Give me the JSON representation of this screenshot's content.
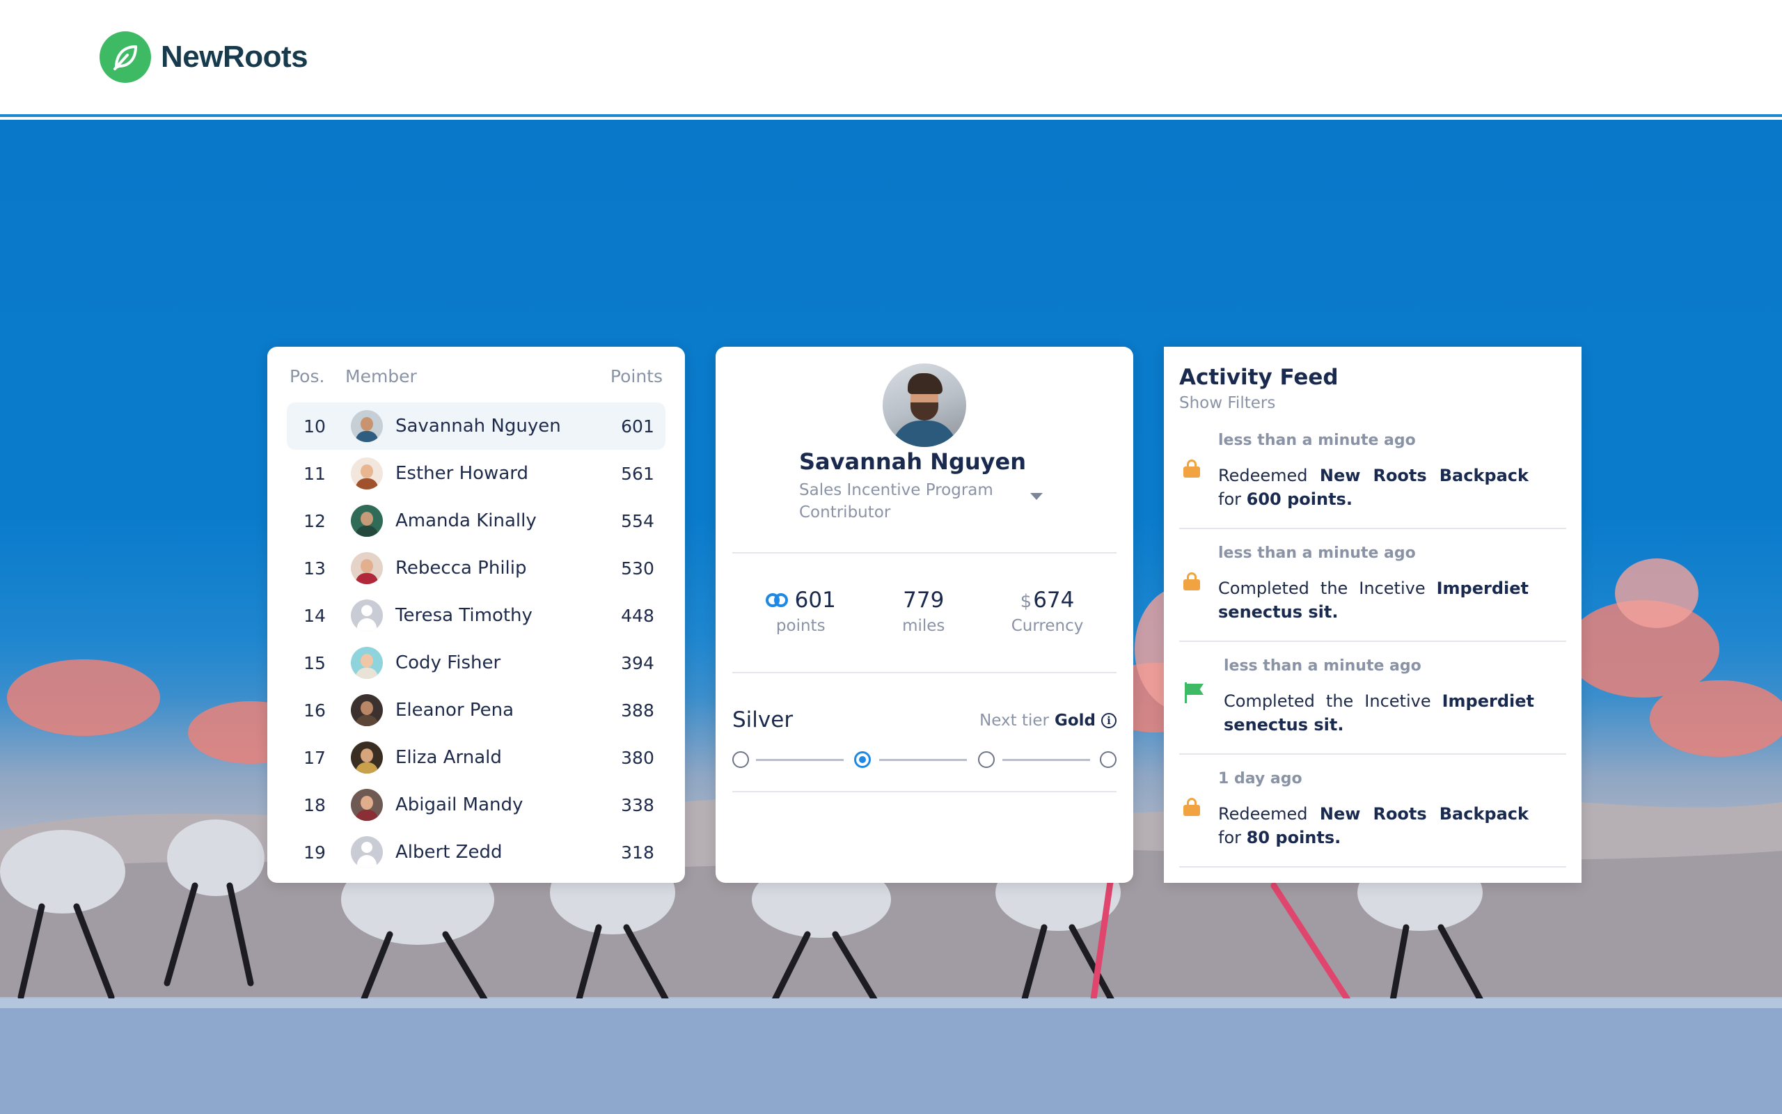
{
  "brand": {
    "name": "NewRoots",
    "logo_icon": "leaf-icon",
    "accent": "#3dba63"
  },
  "leaderboard": {
    "headers": {
      "pos": "Pos.",
      "member": "Member",
      "points": "Points"
    },
    "rows": [
      {
        "pos": "10",
        "name": "Savannah Nguyen",
        "points": "601",
        "avatar": "photo"
      },
      {
        "pos": "11",
        "name": "Esther Howard",
        "points": "561",
        "avatar": "photo"
      },
      {
        "pos": "12",
        "name": "Amanda Kinally",
        "points": "554",
        "avatar": "photo"
      },
      {
        "pos": "13",
        "name": "Rebecca Philip",
        "points": "530",
        "avatar": "photo"
      },
      {
        "pos": "14",
        "name": "Teresa Timothy",
        "points": "448",
        "avatar": "placeholder"
      },
      {
        "pos": "15",
        "name": "Cody Fisher",
        "points": "394",
        "avatar": "photo"
      },
      {
        "pos": "16",
        "name": "Eleanor Pena",
        "points": "388",
        "avatar": "photo"
      },
      {
        "pos": "17",
        "name": "Eliza Arnald",
        "points": "380",
        "avatar": "photo"
      },
      {
        "pos": "18",
        "name": "Abigail Mandy",
        "points": "338",
        "avatar": "photo"
      },
      {
        "pos": "19",
        "name": "Albert Zedd",
        "points": "318",
        "avatar": "placeholder"
      }
    ]
  },
  "profile": {
    "name": "Savannah Nguyen",
    "role": "Sales Incentive Program Contributor",
    "stats": {
      "points_value": "601",
      "points_label": "points",
      "miles_value": "779",
      "miles_label": "miles",
      "currency_symbol": "$",
      "currency_value": "674",
      "currency_label": "Currency"
    },
    "tier": {
      "current": "Silver",
      "next_label": "Next tier",
      "next": "Gold",
      "steps": 4,
      "active_step": 1
    }
  },
  "feed": {
    "title": "Activity Feed",
    "filters_label": "Show Filters",
    "items": [
      {
        "icon": "lock-icon",
        "time": "less than a minute ago",
        "pre": "Redeemed",
        "bold": "New Roots Backpack",
        "mid": "for",
        "bold2": "600 points."
      },
      {
        "icon": "lock-icon",
        "time": "less than a minute ago",
        "pre": "Completed the Incetive",
        "bold": "Imperdiet senectus sit.",
        "mid": "",
        "bold2": ""
      },
      {
        "icon": "flag-icon",
        "time": "less than a minute ago",
        "pre": "Completed the Incetive",
        "bold": "Imperdiet senectus sit.",
        "mid": "",
        "bold2": ""
      },
      {
        "icon": "lock-icon",
        "time": "1 day ago",
        "pre": "Redeemed",
        "bold": "New Roots Backpack",
        "mid": "for",
        "bold2": "80 points."
      }
    ]
  }
}
